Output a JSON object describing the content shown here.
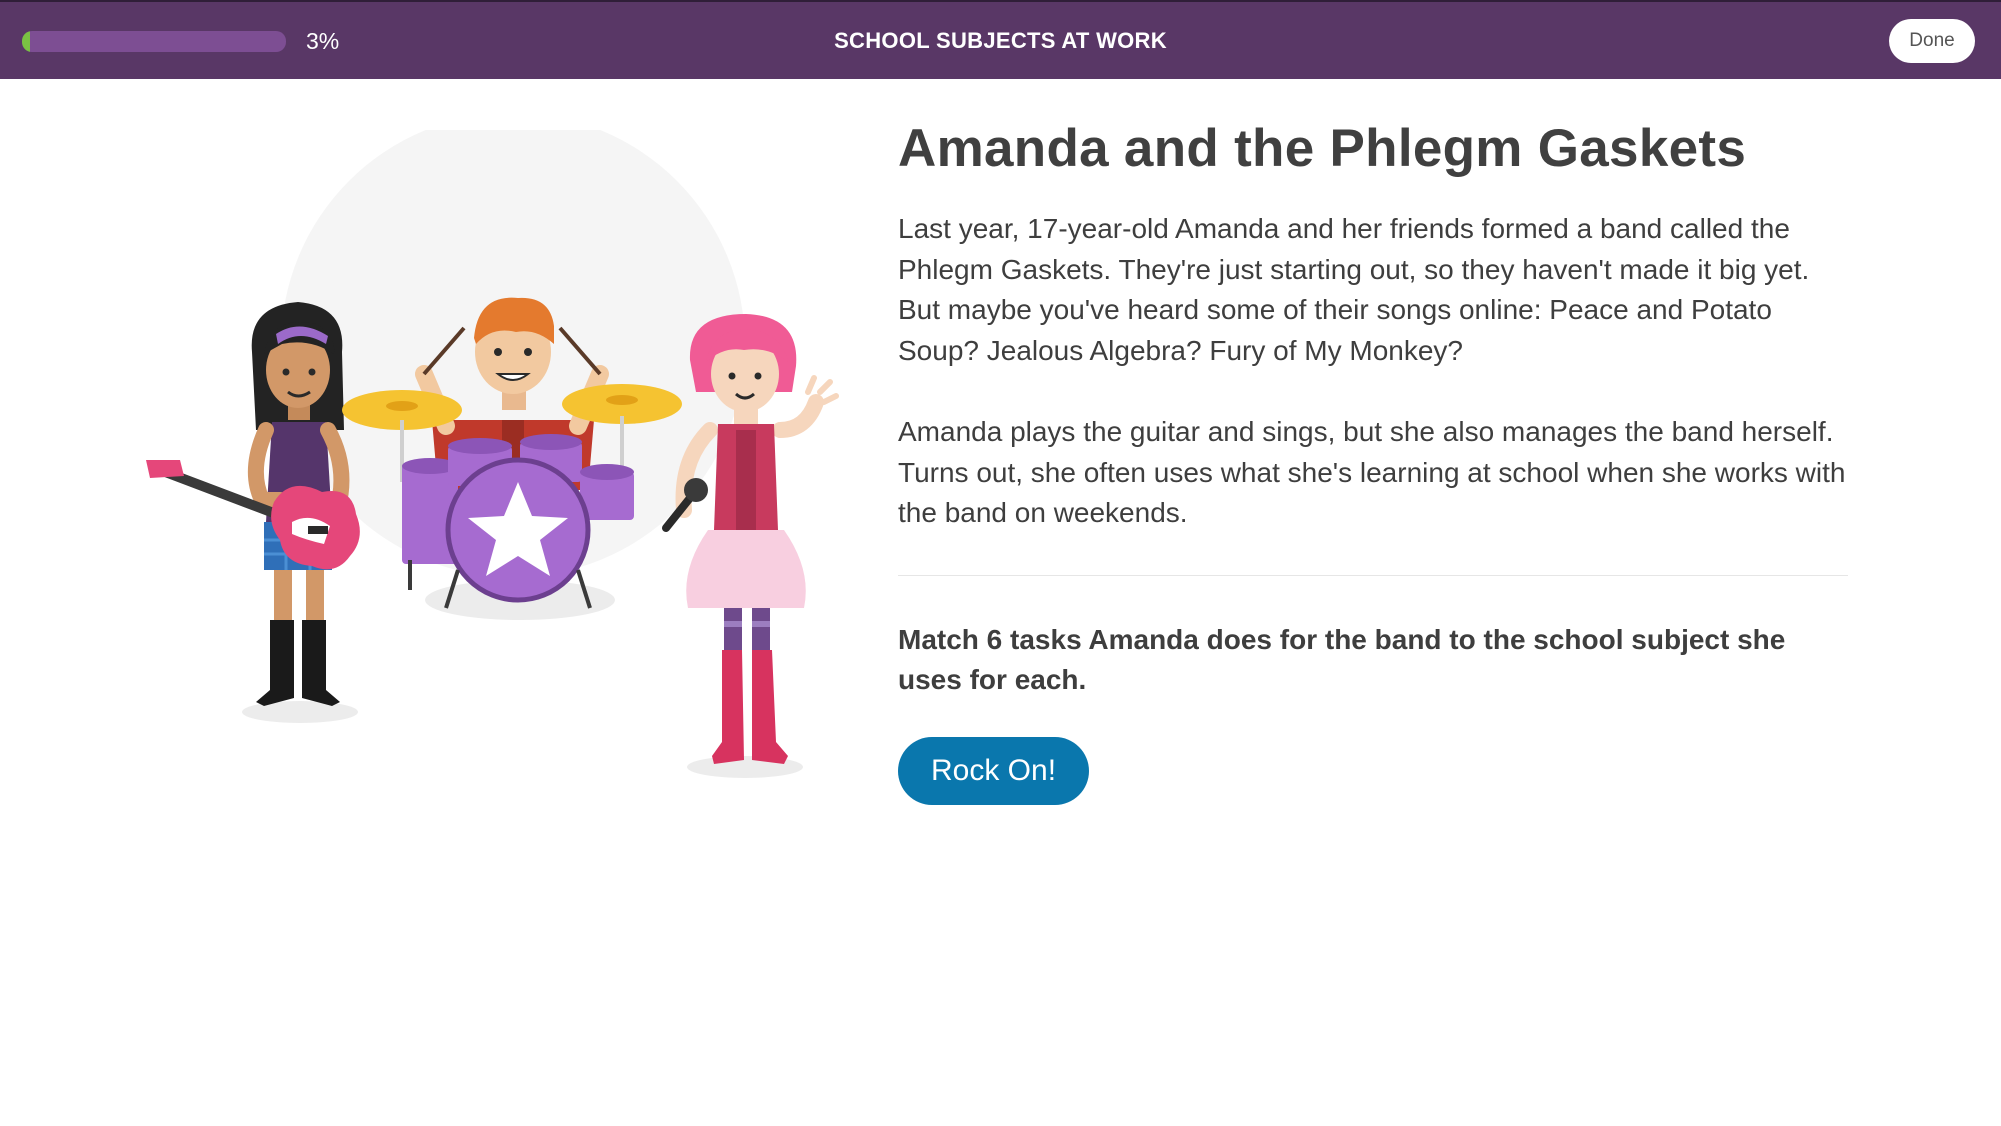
{
  "progress": {
    "value_percent": 3,
    "label": "3%"
  },
  "header": {
    "title": "SCHOOL SUBJECTS AT WORK",
    "done_label": "Done"
  },
  "colors": {
    "header_bg": "#593766",
    "progress_fill": "#7ac143",
    "button_bg": "#0a77ad"
  },
  "lesson": {
    "title": "Amanda and the Phlegm Gaskets",
    "paragraphs": [
      "Last year, 17-year-old Amanda and her friends formed a band called the Phlegm Gaskets. They're just starting out, so they haven't made it big yet. But maybe you've heard some of their songs online: Peace and Potato Soup? Jealous Algebra? Fury of My Monkey?",
      "Amanda plays the guitar and sings, but she also manages the band herself. Turns out, she often uses what she's learning at school when she works with the band on weekends."
    ],
    "instruction": "Match 6 tasks Amanda does for the band to the school subject she uses for each.",
    "button_label": "Rock On!"
  }
}
